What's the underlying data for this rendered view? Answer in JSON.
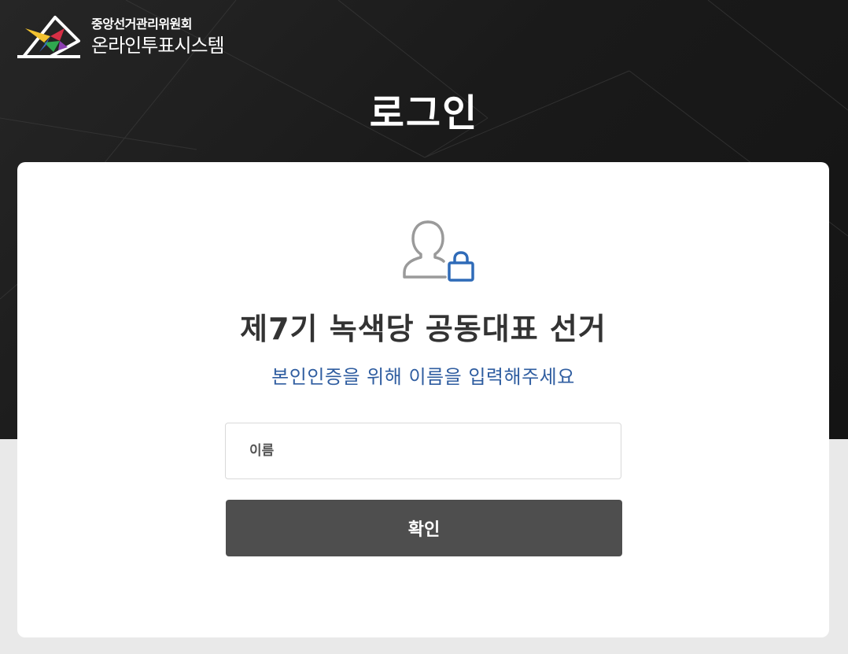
{
  "header": {
    "org_name": "중앙선거관리위원회",
    "system_name": "온라인투표시스템"
  },
  "page": {
    "title": "로그인"
  },
  "login_card": {
    "icon": "user-lock-icon",
    "election_title": "제7기 녹색당 공동대표 선거",
    "instruction": "본인인증을 위해 이름을 입력해주세요",
    "name_field": {
      "placeholder": "이름",
      "value": ""
    },
    "confirm_label": "확인"
  },
  "colors": {
    "hero_background": "#1c1c1c",
    "page_background": "#e9e9e9",
    "card_background": "#ffffff",
    "instruction_text": "#2f5da0",
    "lock_accent": "#2f6bb8",
    "button_background": "#4e4e4e",
    "button_text": "#ffffff"
  }
}
